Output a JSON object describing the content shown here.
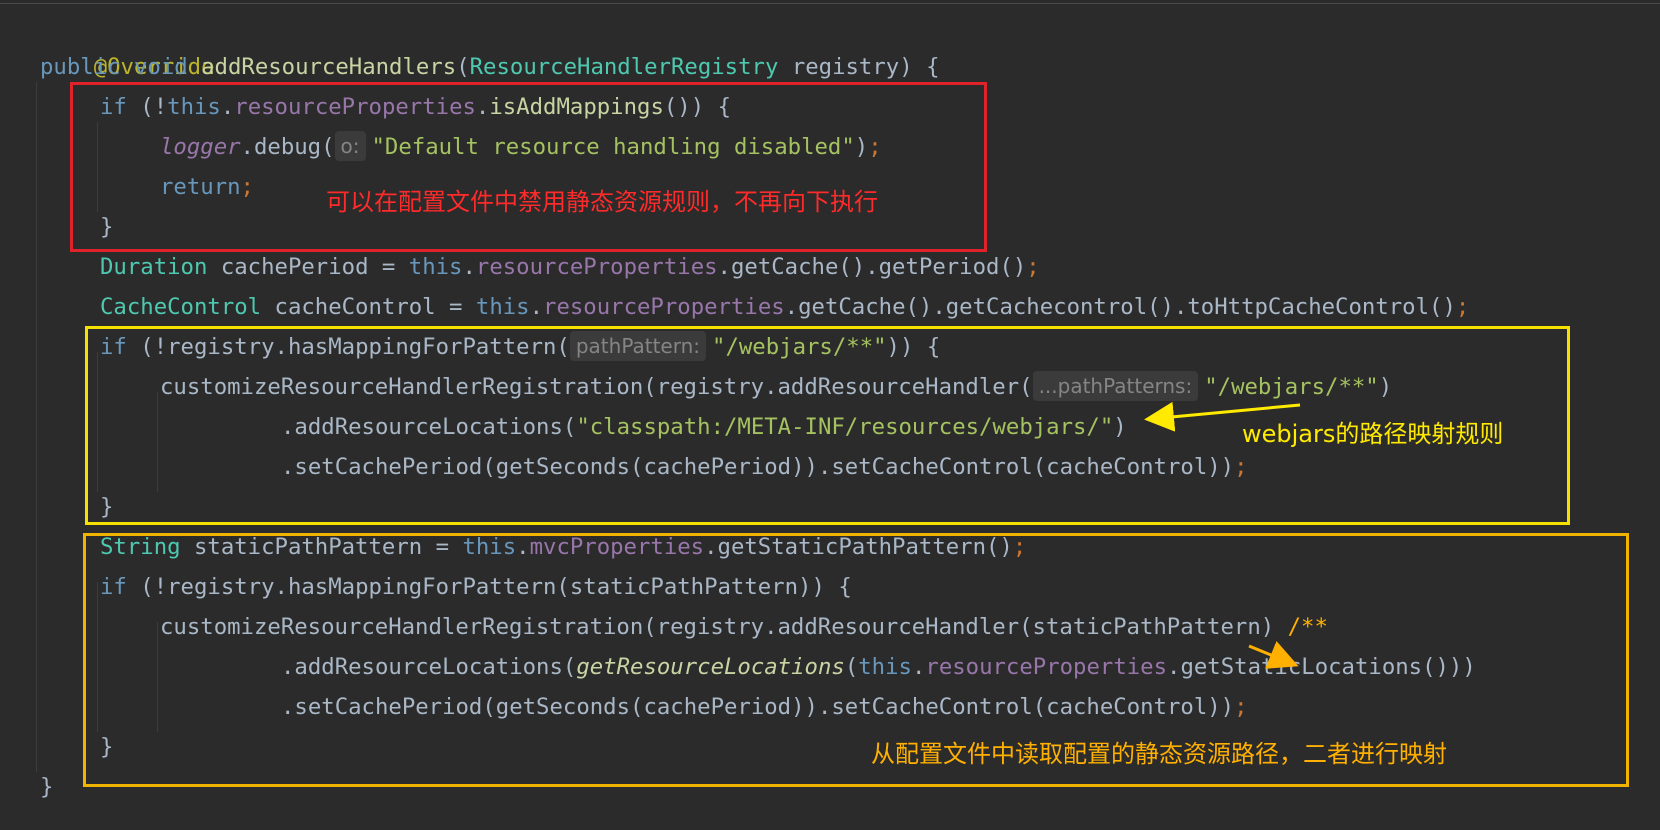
{
  "colors": {
    "background": "#2b2b2b",
    "red_box": "#e0232a",
    "yellow_box": "#f5e000",
    "orange_box": "#f0b400",
    "red_note": "#ff2a2a",
    "yellow_note": "#ffea00",
    "orange_note": "#ffb000"
  },
  "code": {
    "l1": {
      "annotation": "@Override"
    },
    "l2": {
      "public": "public",
      "void": "void",
      "method": "addResourceHandlers",
      "open": "(",
      "type": "ResourceHandlerRegistry",
      "param": "registry",
      "close": ") {"
    },
    "l3": {
      "if": "if",
      "p1": " (!",
      "this": "this",
      "dot1": ".",
      "field": "resourceProperties",
      "dot2": ".",
      "call": "isAddMappings",
      "p2": "()) {"
    },
    "l4": {
      "logger": "logger",
      "p1": ".debug(",
      "hint": "o:",
      "string": "\"Default resource handling disabled\"",
      "close": ")",
      "semi": ";"
    },
    "l5": {
      "return": "return",
      "semi": ";"
    },
    "l6": {
      "brace": "}"
    },
    "l7": {
      "type": "Duration",
      "p1": " cachePeriod = ",
      "this": "this",
      "dot1": ".",
      "field": "resourceProperties",
      "p2": ".getCache().getPeriod()",
      "semi": ";"
    },
    "l8": {
      "type": "CacheControl",
      "p1": " cacheControl = ",
      "this": "this",
      "dot1": ".",
      "field": "resourceProperties",
      "p2": ".getCache().getCachecontrol().toHttpCacheControl()",
      "semi": ";"
    },
    "l9": {
      "if": "if",
      "p1": " (!registry.hasMappingForPattern(",
      "hint": "pathPattern:",
      "string": "\"/webjars/**\"",
      "close": ")) {"
    },
    "l10": {
      "p1": "customizeResourceHandlerRegistration(registry.addResourceHandler(",
      "hint": "...pathPatterns:",
      "string": "\"/webjars/**\"",
      "close": ")"
    },
    "l11": {
      "p1": ".addResourceLocations(",
      "string": "\"classpath:/META-INF/resources/webjars/\"",
      "close": ")"
    },
    "l12": {
      "p1": ".setCachePeriod(getSeconds(cachePeriod)).setCacheControl(cacheControl))",
      "semi": ";"
    },
    "l13": {
      "brace": "}"
    },
    "l14": {
      "type": "String",
      "p1": " staticPathPattern = ",
      "this": "this",
      "dot1": ".",
      "field": "mvcProperties",
      "p2": ".getStaticPathPattern()",
      "semi": ";"
    },
    "l15": {
      "if": "if",
      "p1": " (!registry.hasMappingForPattern(staticPathPattern)) {"
    },
    "l16": {
      "p1": "customizeResourceHandlerRegistration(registry.addResourceHandler(staticPathPattern)",
      "comment": "/**"
    },
    "l17": {
      "p1": ".addResourceLocations(",
      "static": "getResourceLocations",
      "p2": "(",
      "this": "this",
      "dot1": ".",
      "field": "resourceProperties",
      "p3": ".getStaticLocations()))"
    },
    "l18": {
      "p1": ".setCachePeriod(getSeconds(cachePeriod)).setCacheControl(cacheControl))",
      "semi": ";"
    },
    "l19": {
      "brace": "}"
    },
    "l20": {
      "brace": "}"
    }
  },
  "annotations": {
    "red_note": "可以在配置文件中禁用静态资源规则，不再向下执行",
    "yellow_note": "webjars的路径映射规则",
    "orange_note": "从配置文件中读取配置的静态资源路径，二者进行映射"
  }
}
